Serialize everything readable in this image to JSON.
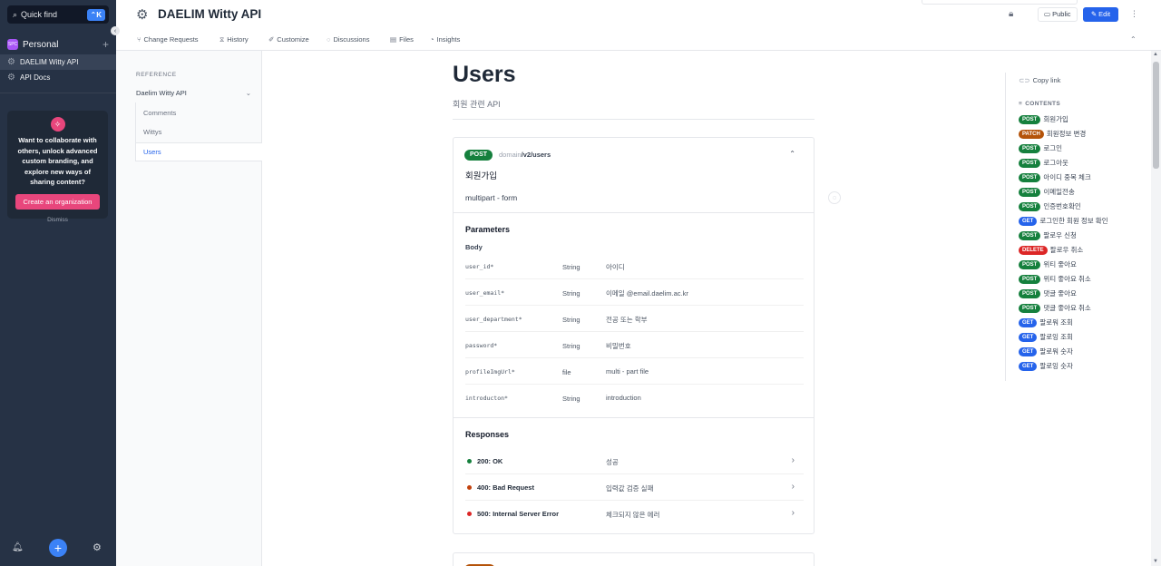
{
  "sidebar": {
    "quickfind_label": "Quick find",
    "quickfind_shortcut": "⌃K",
    "space_avatar": "SPC",
    "space_name": "Personal",
    "items": [
      {
        "label": "DAELIM Witty API"
      },
      {
        "label": "API Docs"
      }
    ],
    "promo": {
      "text": "Want to collaborate with others, unlock advanced custom branding, and explore new ways of sharing content?",
      "cta": "Create an organization",
      "dismiss": "Dismiss"
    }
  },
  "header": {
    "title": "DAELIM Witty API",
    "public_label": "Public",
    "edit_label": "Edit"
  },
  "tabs": [
    {
      "label": "Change Requests"
    },
    {
      "label": "History"
    },
    {
      "label": "Customize"
    },
    {
      "label": "Discussions"
    },
    {
      "label": "Files"
    },
    {
      "label": "Insights"
    }
  ],
  "refnav": {
    "heading": "REFERENCE",
    "group": "Daelim Witty API",
    "items": [
      {
        "label": "Comments"
      },
      {
        "label": "Wittys"
      },
      {
        "label": "Users"
      }
    ]
  },
  "page": {
    "title": "Users",
    "description": "회원 관련 API"
  },
  "operation": {
    "method": "POST",
    "path_prefix": "domain",
    "path": "/v2/users",
    "title": "회원가입",
    "description": "multipart - form",
    "parameters_heading": "Parameters",
    "body_label": "Body",
    "params": [
      {
        "name": "user_id*",
        "type": "String",
        "desc": "아이디"
      },
      {
        "name": "user_email*",
        "type": "String",
        "desc": "이메일 @email.daelim.ac.kr"
      },
      {
        "name": "user_department*",
        "type": "String",
        "desc": "전공 또는 학부"
      },
      {
        "name": "password*",
        "type": "String",
        "desc": "비밀번호"
      },
      {
        "name": "profileImgUrl*",
        "type": "file",
        "desc": "multi - part file"
      },
      {
        "name": "introducton*",
        "type": "String",
        "desc": "introduction"
      }
    ],
    "responses_heading": "Responses",
    "responses": [
      {
        "code": "200: OK",
        "desc": "성공",
        "color": "#15803d"
      },
      {
        "code": "400: Bad Request",
        "desc": "입력값 검증 실패",
        "color": "#c2410c"
      },
      {
        "code": "500: Internal Server Error",
        "desc": "체크되지 않은 에러",
        "color": "#dc2626"
      }
    ]
  },
  "toc": {
    "copy_link": "Copy link",
    "heading": "CONTENTS",
    "items": [
      {
        "method": "POST",
        "label": "회원가입"
      },
      {
        "method": "PATCH",
        "label": "회원정보 변경"
      },
      {
        "method": "POST",
        "label": "로그인"
      },
      {
        "method": "POST",
        "label": "로그아웃"
      },
      {
        "method": "POST",
        "label": "아이디 중복 체크"
      },
      {
        "method": "POST",
        "label": "이메일전송"
      },
      {
        "method": "POST",
        "label": "인증번호확인"
      },
      {
        "method": "GET",
        "label": "로그인한 회원 정보 확인"
      },
      {
        "method": "POST",
        "label": "팔로우 신청"
      },
      {
        "method": "DELETE",
        "label": "팔로우 취소"
      },
      {
        "method": "POST",
        "label": "위티 좋아요"
      },
      {
        "method": "POST",
        "label": "위티 좋아요 취소"
      },
      {
        "method": "POST",
        "label": "댓글 좋아요"
      },
      {
        "method": "POST",
        "label": "댓글 좋아요 취소"
      },
      {
        "method": "GET",
        "label": "팔로워 조회"
      },
      {
        "method": "GET",
        "label": "팔로잉 조회"
      },
      {
        "method": "GET",
        "label": "팔로워 숫자"
      },
      {
        "method": "GET",
        "label": "팔로잉 숫자"
      }
    ]
  },
  "colors": {
    "accent": "#2563eb",
    "post": "#15803d",
    "patch": "#b45309",
    "get": "#2563eb",
    "delete": "#dc2626",
    "promo_cta": "#e8467c"
  }
}
